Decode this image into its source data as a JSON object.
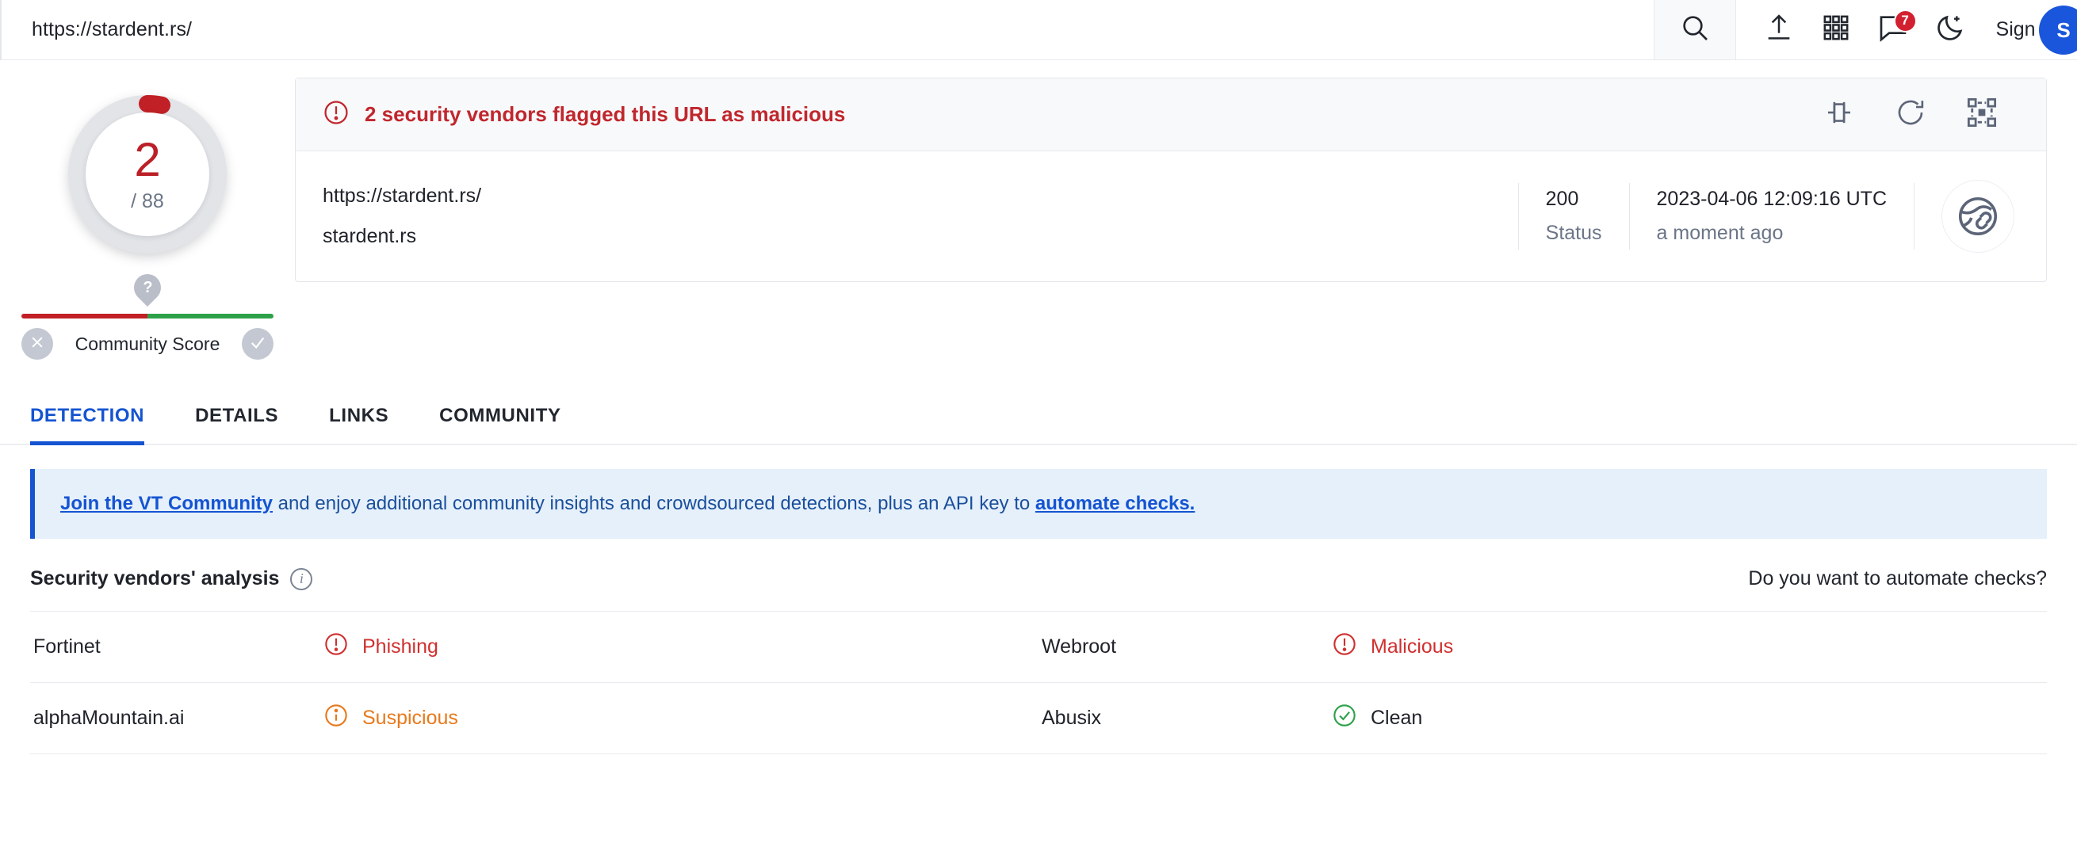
{
  "topnav": {
    "url": "https://stardent.rs/",
    "icons": [
      {
        "name": "search-icon",
        "label": "Search"
      },
      {
        "name": "upload-icon",
        "label": "Upload"
      },
      {
        "name": "apps-grid-icon",
        "label": "Apps"
      },
      {
        "name": "comments-icon",
        "label": "Comments",
        "badge": "7"
      },
      {
        "name": "dark-mode-icon",
        "label": "Dark mode"
      }
    ],
    "notification_count": "7",
    "sign_in": "Sign in",
    "sign_up_initial": "S"
  },
  "score": {
    "detections": "2",
    "total": "/ 88",
    "community_label": "Community Score",
    "pin_glyph": "?",
    "red_fraction": 50,
    "colors": {
      "bad": "#bb2026",
      "good": "#2da14a",
      "neutral": "#b9bec9"
    }
  },
  "card": {
    "verdict": "2 security vendors flagged this URL as malicious",
    "actions": [
      {
        "name": "plugin-icon",
        "label": "Plugins"
      },
      {
        "name": "reanalyze-icon",
        "label": "Reanalyze"
      },
      {
        "name": "graph-pivot-icon",
        "label": "Open in graph"
      }
    ],
    "url": "https://stardent.rs/",
    "host": "stardent.rs",
    "status_value": "200",
    "status_label": "Status",
    "scan_date": "2023-04-06 12:09:16 UTC",
    "scan_relative": "a moment ago",
    "type_icon": "globe-link-icon"
  },
  "tabs": [
    {
      "label": "DETECTION",
      "active": true
    },
    {
      "label": "DETAILS",
      "active": false
    },
    {
      "label": "LINKS",
      "active": false
    },
    {
      "label": "COMMUNITY",
      "active": false
    }
  ],
  "join_banner": {
    "link1": "Join the VT Community",
    "mid": " and enjoy additional community insights and crowdsourced detections, plus an API key to ",
    "link2": "automate checks."
  },
  "vendors_section": {
    "title": "Security vendors' analysis",
    "automate_text": "Do you want to automate checks?",
    "rows": [
      {
        "left": {
          "vendor": "Fortinet",
          "result": "Phishing",
          "status": "malicious",
          "icon": "exclamation-circle-icon"
        },
        "right": {
          "vendor": "Webroot",
          "result": "Malicious",
          "status": "malicious",
          "icon": "exclamation-circle-icon"
        }
      },
      {
        "left": {
          "vendor": "alphaMountain.ai",
          "result": "Suspicious",
          "status": "suspicious",
          "icon": "info-circle-icon"
        },
        "right": {
          "vendor": "Abusix",
          "result": "Clean",
          "status": "clean",
          "icon": "check-circle-icon"
        }
      }
    ]
  }
}
